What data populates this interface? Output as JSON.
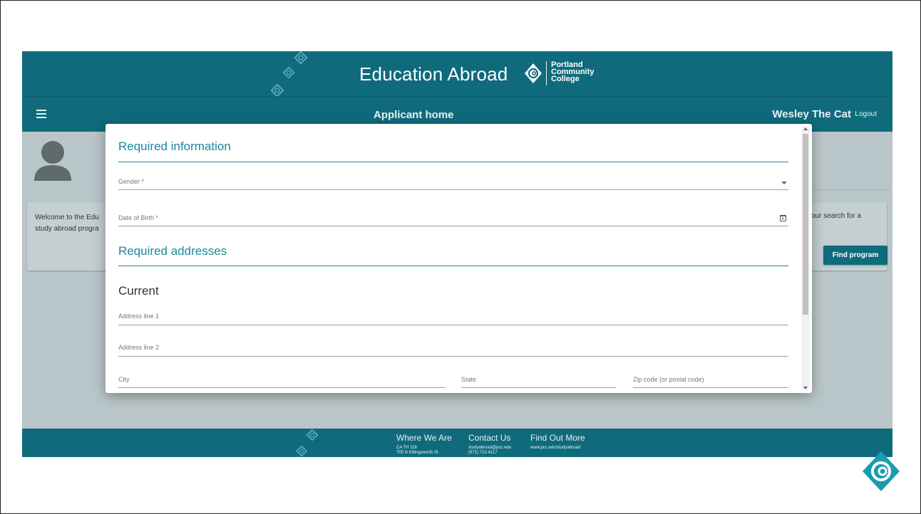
{
  "banner": {
    "title": "Education Abroad",
    "college_lines": [
      "Portland",
      "Community",
      "College"
    ]
  },
  "navbar": {
    "page_title": "Applicant home",
    "user_name": "Wesley The Cat",
    "logout_label": "Logout"
  },
  "background": {
    "welcome_left_line1": "Welcome to the Edu",
    "welcome_left_line2": "study abroad progra",
    "welcome_right": "our search for a",
    "find_program_label": "Find program"
  },
  "modal": {
    "required_info_title": "Required information",
    "gender_label": "Gender *",
    "dob_label": "Date of Birth *",
    "required_addresses_title": "Required addresses",
    "current_label": "Current",
    "address1_label": "Address line 1",
    "address2_label": "Address line 2",
    "city_label": "City",
    "state_label": "State",
    "zip_label": "Zip code (or postal code)"
  },
  "footer": {
    "where_title": "Where We Are",
    "where_line1": "CA TH 116",
    "where_line2": "705 N Killingsworth St.",
    "contact_title": "Contact Us",
    "contact_line1": "studyabroad@pcc.edu",
    "contact_line2": "(971) 722-4117",
    "more_title": "Find Out More",
    "more_line1": "www.pcc.edu/studyabroad"
  },
  "colors": {
    "brand_teal": "#0f6b7c",
    "accent_teal": "#1a8a9c",
    "overlay_bg": "#b9c6c9"
  },
  "icons": [
    "menu-icon",
    "avatar-icon",
    "dropdown-caret-icon",
    "calendar-icon",
    "pcc-swirl-logo-icon"
  ]
}
